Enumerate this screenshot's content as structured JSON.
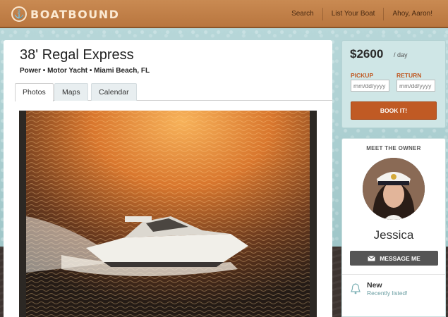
{
  "brand": {
    "name": "BOATBOUND",
    "logo_glyph": "⚓"
  },
  "nav": {
    "search": "Search",
    "list_boat": "List Your Boat",
    "greeting": "Ahoy, Aaron!"
  },
  "listing": {
    "title": "38' Regal Express",
    "subtitle": "Power • Motor Yacht • Miami Beach, FL",
    "tabs": [
      "Photos",
      "Maps",
      "Calendar"
    ],
    "active_tab": "Photos"
  },
  "booking": {
    "price": "$2600",
    "per": "/ day",
    "pickup_label": "PICKUP",
    "return_label": "RETURN",
    "pickup_placeholder": "mm/dd/yyyy",
    "return_placeholder": "mm/dd/yyyy",
    "book_label": "BOOK IT!"
  },
  "owner": {
    "heading": "MEET THE OWNER",
    "name": "Jessica",
    "message_label": "MESSAGE ME",
    "status_title": "New",
    "status_sub": "Recently listed!"
  },
  "colors": {
    "accent": "#c05a24",
    "header": "#c98a52",
    "page_bg": "#a9cdd0",
    "status_text": "#6a9ea2"
  },
  "icons": {
    "logo": "anchor-icon",
    "message": "envelope-icon",
    "status": "bell-icon"
  }
}
